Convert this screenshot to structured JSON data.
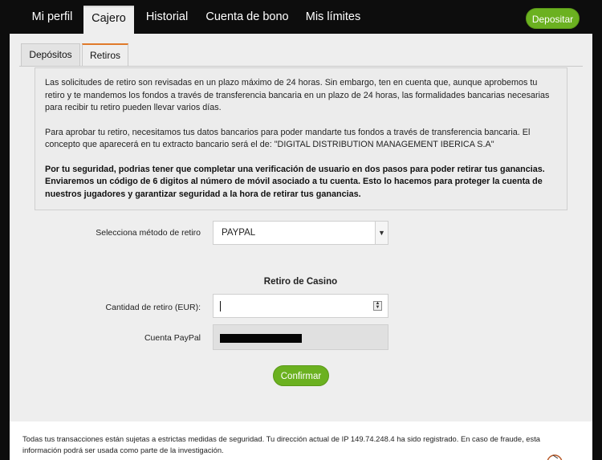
{
  "nav": {
    "tabs": [
      {
        "label": "Mi perfil"
      },
      {
        "label": "Cajero"
      },
      {
        "label": "Historial"
      },
      {
        "label": "Cuenta de bono"
      },
      {
        "label": "Mis límites"
      }
    ],
    "active": "Cajero",
    "deposit_label": "Depositar"
  },
  "subtabs": {
    "items": [
      {
        "label": "Depósitos"
      },
      {
        "label": "Retiros"
      }
    ],
    "active": "Retiros"
  },
  "info": {
    "p1": "Las solicitudes de retiro son revisadas en un plazo máximo de 24 horas. Sin embargo, ten en cuenta que, aunque aprobemos tu retiro y te mandemos los fondos a través de transferencia bancaria en un plazo de 24 horas, las formalidades bancarias necesarias para recibir tu retiro pueden llevar varios días.",
    "p2": "Para aprobar tu retiro, necesitamos tus datos bancarios para poder mandarte tus fondos a través de transferencia bancaria. El concepto que aparecerá en tu extracto bancario será el de: \"DIGITAL DISTRIBUTION MANAGEMENT IBERICA S.A\"",
    "p3": "Por tu seguridad, podrias tener que completar una verificación de usuario en dos pasos para poder retirar tus ganancias. Enviaremos un código de 6 digitos al número de móvil asociado a tu cuenta. Esto lo hacemos para proteger la cuenta de nuestros jugadores y garantizar seguridad a la hora de retirar tus ganancias."
  },
  "form": {
    "method_label": "Selecciona método de retiro",
    "method_value": "PAYPAL",
    "section_title": "Retiro de Casino",
    "amount_label": "Cantidad de retiro (EUR):",
    "amount_value": "",
    "paypal_label": "Cuenta PayPal",
    "confirm_label": "Confirmar"
  },
  "footer": {
    "text": "Todas tus transacciones están sujetas a estrictas medidas de seguridad. Tu dirección actual de IP 149.74.248.4 ha sido registrado. En caso de fraude, esta información podrá ser usada como parte de la investigación."
  },
  "colors": {
    "accent_green": "#6bb120",
    "active_subtab_border": "#e07a2a",
    "nav_bg": "#0d0d0d"
  }
}
